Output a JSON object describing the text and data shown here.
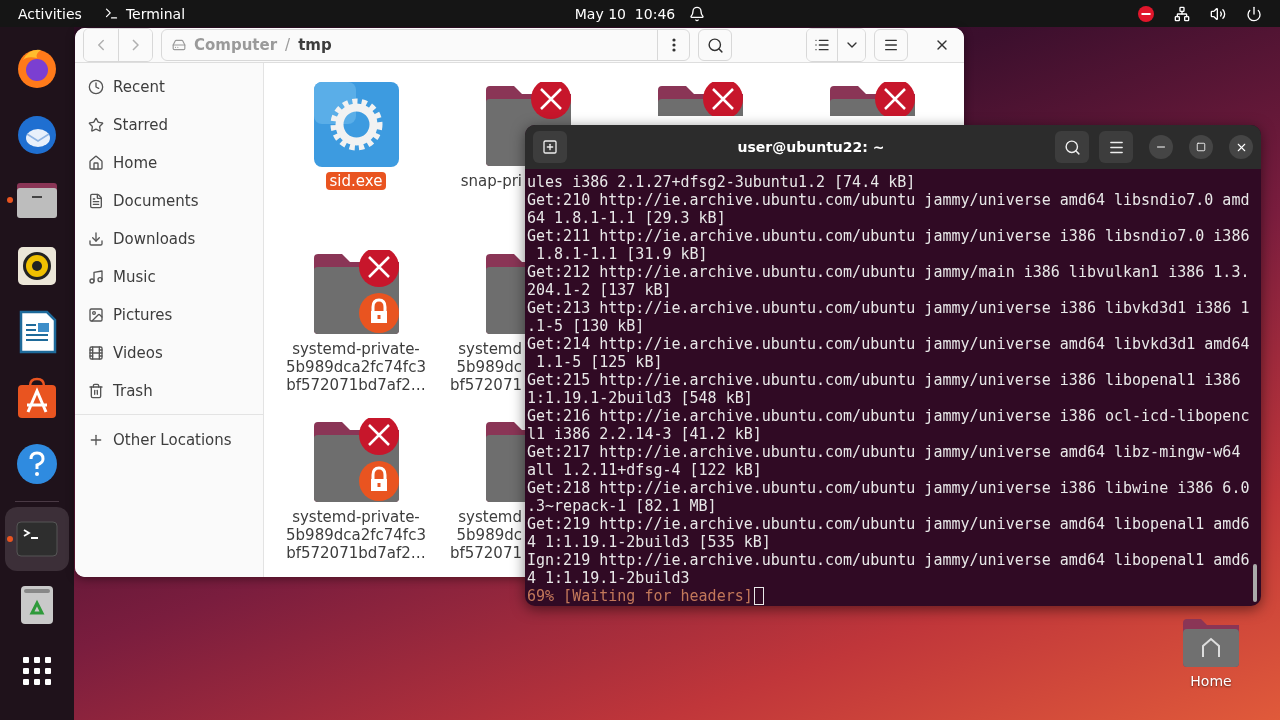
{
  "top_bar": {
    "activities": "Activities",
    "app_menu": "Terminal",
    "clock": "May 10  10:46"
  },
  "dock": {
    "apps": [
      {
        "kind": "browser",
        "running": false
      },
      {
        "kind": "mail",
        "running": false
      },
      {
        "kind": "files",
        "running": true
      },
      {
        "kind": "music",
        "running": false
      },
      {
        "kind": "writer",
        "running": false
      },
      {
        "kind": "store",
        "running": false
      },
      {
        "kind": "help",
        "running": false
      },
      {
        "kind": "terminal",
        "running": true,
        "selected": true
      },
      {
        "kind": "trash",
        "running": false
      }
    ]
  },
  "file_manager": {
    "path": [
      "Computer",
      "tmp"
    ],
    "path_separator": "/",
    "sidebar": [
      {
        "kind": "recent",
        "label": "Recent"
      },
      {
        "kind": "starred",
        "label": "Starred"
      },
      {
        "kind": "home",
        "label": "Home"
      },
      {
        "kind": "documents",
        "label": "Documents"
      },
      {
        "kind": "downloads",
        "label": "Downloads"
      },
      {
        "kind": "music",
        "label": "Music"
      },
      {
        "kind": "pictures",
        "label": "Pictures"
      },
      {
        "kind": "videos",
        "label": "Videos"
      },
      {
        "kind": "trash",
        "label": "Trash"
      }
    ],
    "other_locations": "Other Locations",
    "files": [
      [
        {
          "kind": "exe",
          "name_lines": [
            "sid.exe"
          ],
          "selected": true
        },
        {
          "kind": "folder-blocked",
          "name_lines": [
            "snap-pri"
          ],
          "selected": false
        },
        {
          "kind": "folder-blocked"
        },
        {
          "kind": "folder-blocked"
        }
      ],
      [
        {
          "kind": "folder-locked",
          "name_lines": [
            "systemd-private-",
            "5b989dca2fc74fc3",
            "bf572071bd7af2…"
          ],
          "selected": false
        },
        {
          "kind": "folder-locked",
          "name_lines": [
            "systemd",
            "5b989dc",
            "bf572071"
          ],
          "selected": false
        }
      ],
      [
        {
          "kind": "folder-locked",
          "name_lines": [
            "systemd-private-",
            "5b989dca2fc74fc3",
            "bf572071bd7af2…"
          ],
          "selected": false
        },
        {
          "kind": "folder-locked",
          "name_lines": [
            "systemd",
            "5b989dc",
            "bf572071"
          ],
          "selected": false
        }
      ]
    ]
  },
  "terminal": {
    "title": "user@ubuntu22: ~",
    "lines": [
      "ules i386 2.1.27+dfsg2-3ubuntu1.2 [74.4 kB]",
      "Get:210 http://ie.archive.ubuntu.com/ubuntu jammy/universe amd64 libsndio7.0 amd",
      "64 1.8.1-1.1 [29.3 kB]",
      "Get:211 http://ie.archive.ubuntu.com/ubuntu jammy/universe i386 libsndio7.0 i386",
      " 1.8.1-1.1 [31.9 kB]",
      "Get:212 http://ie.archive.ubuntu.com/ubuntu jammy/main i386 libvulkan1 i386 1.3.",
      "204.1-2 [137 kB]",
      "Get:213 http://ie.archive.ubuntu.com/ubuntu jammy/universe i386 libvkd3d1 i386 1",
      ".1-5 [130 kB]",
      "Get:214 http://ie.archive.ubuntu.com/ubuntu jammy/universe amd64 libvkd3d1 amd64",
      " 1.1-5 [125 kB]",
      "Get:215 http://ie.archive.ubuntu.com/ubuntu jammy/universe i386 libopenal1 i386",
      "1:1.19.1-2build3 [548 kB]",
      "Get:216 http://ie.archive.ubuntu.com/ubuntu jammy/universe i386 ocl-icd-libopenc",
      "l1 i386 2.2.14-3 [41.2 kB]",
      "Get:217 http://ie.archive.ubuntu.com/ubuntu jammy/universe amd64 libz-mingw-w64",
      "all 1.2.11+dfsg-4 [122 kB]",
      "Get:218 http://ie.archive.ubuntu.com/ubuntu jammy/universe i386 libwine i386 6.0",
      ".3~repack-1 [82.1 MB]",
      "Get:219 http://ie.archive.ubuntu.com/ubuntu jammy/universe amd64 libopenal1 amd6",
      "4 1:1.19.1-2build3 [535 kB]",
      "Ign:219 http://ie.archive.ubuntu.com/ubuntu jammy/universe amd64 libopenal1 amd6",
      "4 1:1.19.1-2build3"
    ],
    "status": "69% [Waiting for headers]"
  },
  "desktop_icons": [
    {
      "kind": "home",
      "label": "Home"
    }
  ]
}
